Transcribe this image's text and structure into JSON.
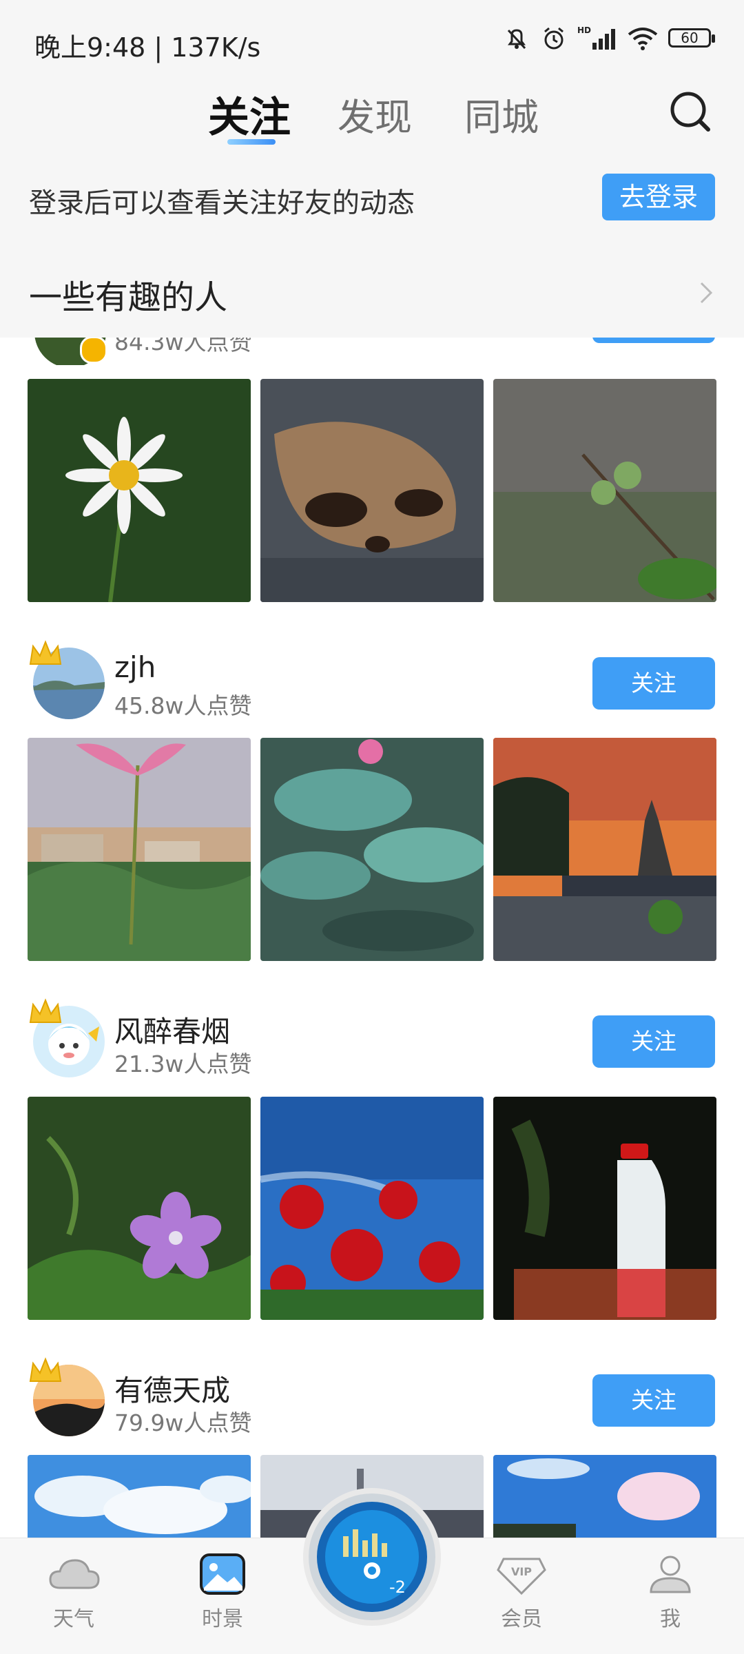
{
  "status_bar": {
    "time": "晚上9:48 | 137K/s",
    "battery": "60",
    "network_label": "HD"
  },
  "tabs": [
    {
      "label": "关注",
      "active": true
    },
    {
      "label": "发现",
      "active": false
    },
    {
      "label": "同城",
      "active": false
    }
  ],
  "login": {
    "prompt": "登录后可以查看关注好友的动态",
    "button_label": "去登录"
  },
  "section": {
    "title": "一些有趣的人"
  },
  "partial_card": {
    "likes": "84.3w人点赞"
  },
  "users": [
    {
      "name": "zjh",
      "likes": "45.8w人点赞",
      "follow_label": "关注"
    },
    {
      "name": "风醉春烟",
      "likes": "21.3w人点赞",
      "follow_label": "关注"
    },
    {
      "name": "有德天成",
      "likes": "79.9w人点赞",
      "follow_label": "关注"
    }
  ],
  "center_disc": {
    "value": "-2"
  },
  "bottom_nav": [
    {
      "label": "天气",
      "icon": "cloud-icon",
      "active": false
    },
    {
      "label": "时景",
      "icon": "picture-icon",
      "active": true
    },
    {
      "label": "会员",
      "icon": "vip-icon",
      "active": false
    },
    {
      "label": "我",
      "icon": "person-icon",
      "active": false
    }
  ],
  "colors": {
    "accent": "#3f9ef6",
    "header_bg": "#f6f6f6"
  }
}
